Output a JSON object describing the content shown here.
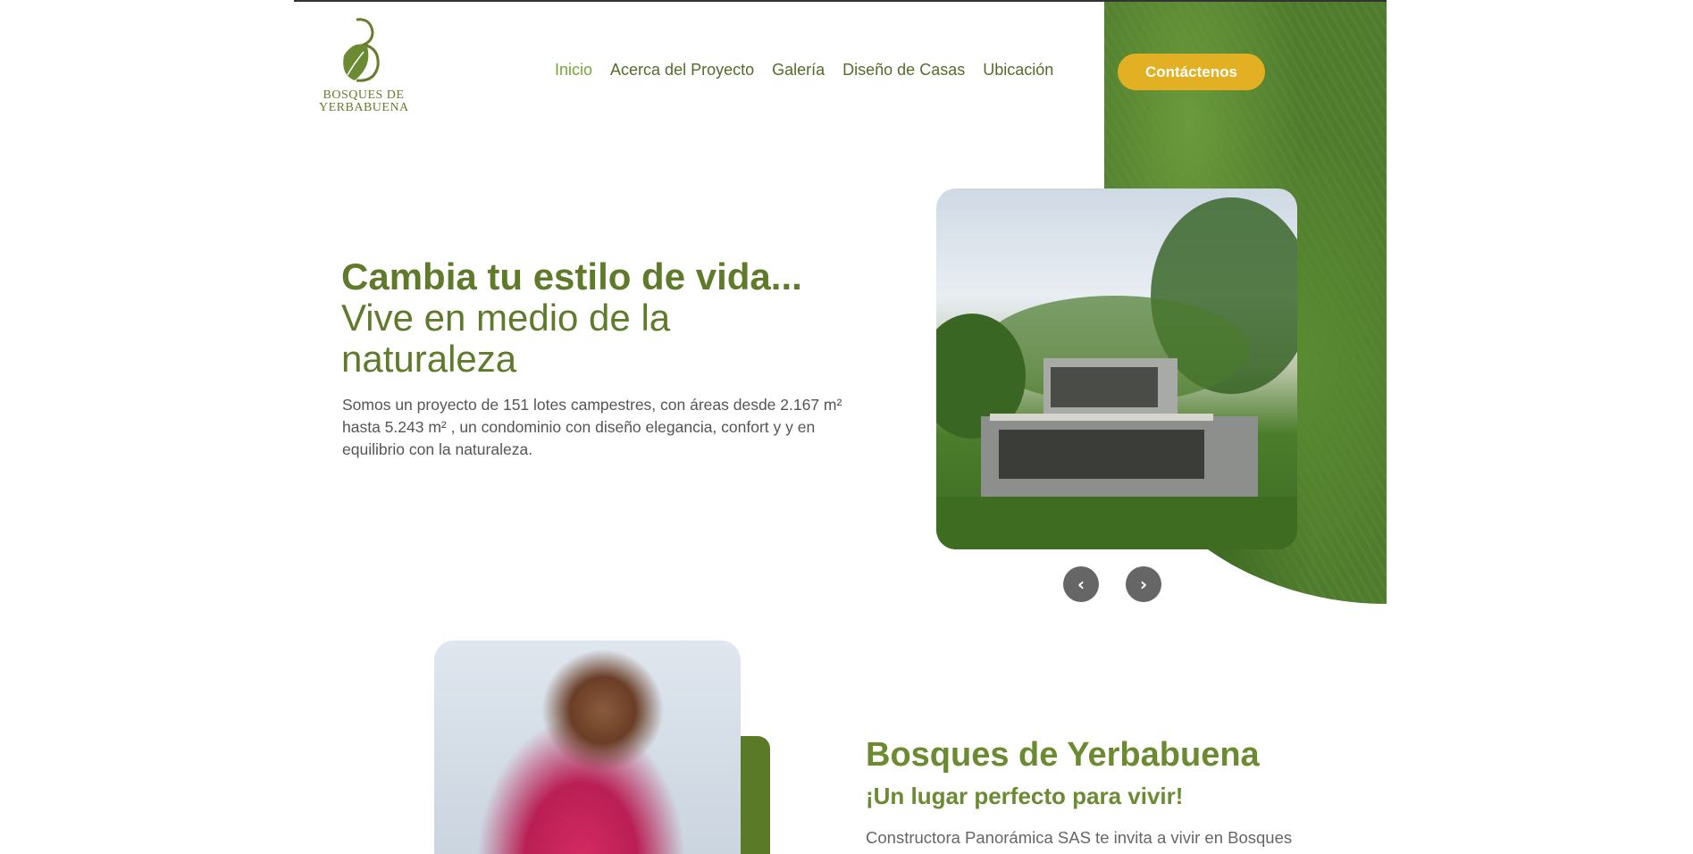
{
  "header": {
    "logo_line1": "BOSQUES DE",
    "logo_line2": "YERBABUENA",
    "nav": [
      {
        "label": "Inicio",
        "active": true
      },
      {
        "label": "Acerca del Proyecto"
      },
      {
        "label": "Galería"
      },
      {
        "label": "Diseño de Casas"
      },
      {
        "label": "Ubicación"
      }
    ],
    "cta_label": "Contáctenos"
  },
  "hero": {
    "title_bold": "Cambia tu estilo de vida...",
    "title_rest": "Vive en medio de la naturaleza",
    "description": "Somos un proyecto de 151 lotes campestres, con áreas desde 2.167 m² hasta 5.243 m² , un condominio con diseño elegancia, confort y y en equilibrio con la naturaleza.",
    "prev_icon": "chevron-left-icon",
    "next_icon": "chevron-right-icon"
  },
  "section2": {
    "title": "Bosques de Yerbabuena",
    "subtitle": "¡Un lugar perfecto para vivir!",
    "text": "Constructora Panorámica SAS te invita a vivir en Bosques"
  },
  "colors": {
    "brand_green": "#5f7a2a",
    "accent_yellow": "#e3b023",
    "nav_active": "#7aa43a"
  }
}
